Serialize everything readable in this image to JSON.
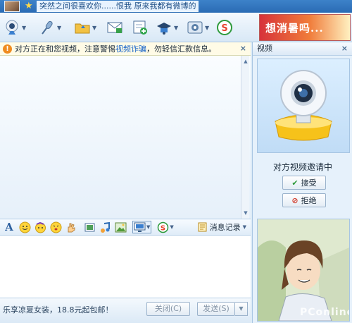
{
  "title_bar": {
    "signature": "突然之间很喜欢你......恨我   原来我都有微博的"
  },
  "toolbar": {
    "buttons": [
      {
        "name": "video-call",
        "icon": "camera-icon"
      },
      {
        "name": "voice-call",
        "icon": "microphone-icon"
      },
      {
        "name": "send-file",
        "icon": "folder-icon"
      },
      {
        "name": "send-sms",
        "icon": "sms-icon"
      },
      {
        "name": "add-friend",
        "icon": "add-icon"
      },
      {
        "name": "remote-assist",
        "icon": "hat-icon"
      },
      {
        "name": "settings",
        "icon": "gear-icon"
      },
      {
        "name": "app",
        "icon": "s-logo-icon"
      }
    ],
    "ad_banner": "想消暑吗..."
  },
  "warning": {
    "text_before": "对方正在和您视频，注意警惕",
    "link": "视频诈骗",
    "text_after": "，勿轻信汇款信息。",
    "close": "×"
  },
  "input_toolbar": {
    "message_record": "消息记录"
  },
  "bottom": {
    "ad_text": "乐享凉夏女装，18.8元起包邮！",
    "close_button": "关闭(C)",
    "send_button": "发送(S)"
  },
  "side_panel": {
    "title": "视频",
    "close": "×",
    "invite_status": "对方视频邀请中",
    "accept_button": "接受",
    "decline_button": "拒绝",
    "watermark": "PConline"
  },
  "colors": {
    "accent": "#2a6bb4",
    "warning_bg": "#fffbe6",
    "link": "#1b66c9"
  }
}
